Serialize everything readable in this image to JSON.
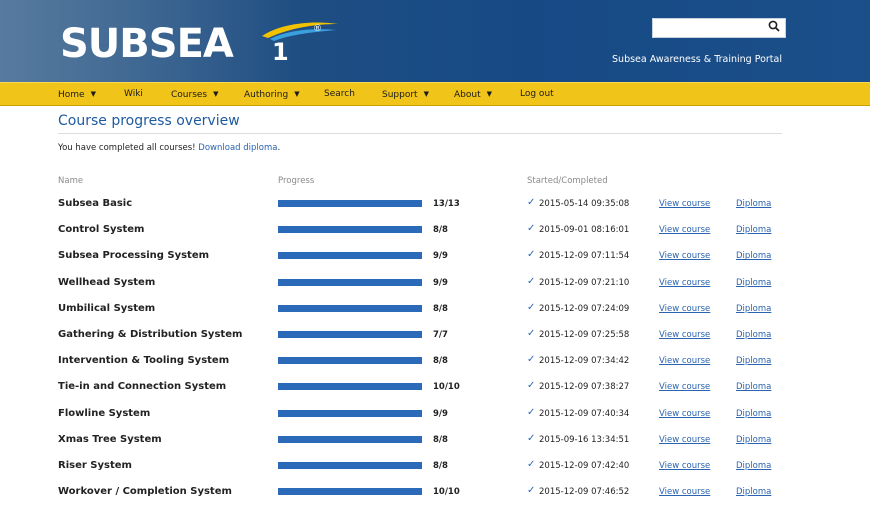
{
  "header": {
    "logo_text": "SUBSEA",
    "logo_number": "1",
    "logo_registered": "®",
    "portal_title": "Subsea Awareness & Training Portal",
    "search_value": ""
  },
  "nav": {
    "items": [
      {
        "label": "Home",
        "caret": true
      },
      {
        "label": "Wiki",
        "caret": false
      },
      {
        "label": "Courses",
        "caret": true
      },
      {
        "label": "Authoring",
        "caret": true
      },
      {
        "label": "Search",
        "caret": false
      },
      {
        "label": "Support",
        "caret": true
      },
      {
        "label": "About",
        "caret": true
      },
      {
        "label": "Log out",
        "caret": false
      }
    ]
  },
  "main": {
    "title": "Course progress overview",
    "notice_text": "You have completed all courses! ",
    "notice_link": "Download diploma",
    "notice_end": ".",
    "columns": {
      "name": "Name",
      "progress": "Progress",
      "started": "Started/Completed"
    },
    "view_label": "View course",
    "diploma_label": "Diploma",
    "courses": [
      {
        "name": "Subsea Basic",
        "progress": "13/13",
        "fraction": 1.0,
        "date": "2015-05-14 09:35:08"
      },
      {
        "name": "Control System",
        "progress": "8/8",
        "fraction": 1.0,
        "date": "2015-09-01 08:16:01"
      },
      {
        "name": "Subsea Processing System",
        "progress": "9/9",
        "fraction": 1.0,
        "date": "2015-12-09 07:11:54"
      },
      {
        "name": "Wellhead System",
        "progress": "9/9",
        "fraction": 1.0,
        "date": "2015-12-09 07:21:10"
      },
      {
        "name": "Umbilical System",
        "progress": "8/8",
        "fraction": 1.0,
        "date": "2015-12-09 07:24:09"
      },
      {
        "name": "Gathering & Distribution System",
        "progress": "7/7",
        "fraction": 1.0,
        "date": "2015-12-09 07:25:58"
      },
      {
        "name": "Intervention & Tooling System",
        "progress": "8/8",
        "fraction": 1.0,
        "date": "2015-12-09 07:34:42"
      },
      {
        "name": "Tie-in and Connection System",
        "progress": "10/10",
        "fraction": 1.0,
        "date": "2015-12-09 07:38:27"
      },
      {
        "name": "Flowline System",
        "progress": "9/9",
        "fraction": 1.0,
        "date": "2015-12-09 07:40:34"
      },
      {
        "name": "Xmas Tree System",
        "progress": "8/8",
        "fraction": 1.0,
        "date": "2015-09-16 13:34:51"
      },
      {
        "name": "Riser System",
        "progress": "8/8",
        "fraction": 1.0,
        "date": "2015-12-09 07:42:40"
      },
      {
        "name": "Workover / Completion System",
        "progress": "10/10",
        "fraction": 1.0,
        "date": "2015-12-09 07:46:52"
      }
    ]
  },
  "colors": {
    "header_blue": "#1e4d82",
    "nav_yellow": "#f0c419",
    "link_blue": "#2a64b0",
    "bar_blue": "#2a6ab8"
  },
  "icons": {
    "search": "search-icon",
    "check": "check-icon",
    "caret": "caret-down-icon"
  }
}
